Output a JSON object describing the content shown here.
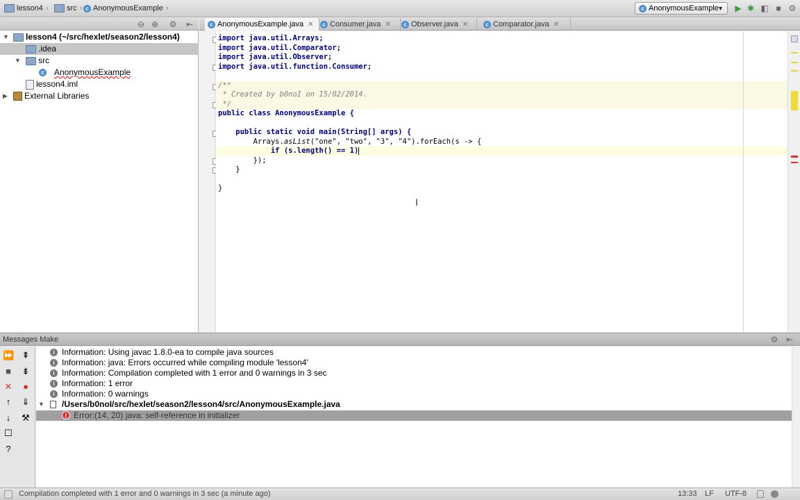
{
  "breadcrumbs": [
    {
      "label": "lesson4",
      "icon": "folder-icon"
    },
    {
      "label": "src",
      "icon": "folder-icon"
    },
    {
      "label": "AnonymousExample",
      "icon": "class-icon"
    }
  ],
  "toolbar": {
    "run_config": "AnonymousExample"
  },
  "project_tree": [
    {
      "label": "lesson4 (~/src/hexlet/season2/lesson4)",
      "icon": "folder-icon",
      "depth": 0,
      "expanded": true
    },
    {
      "label": ".idea",
      "icon": "folder-icon",
      "depth": 1,
      "selected": true
    },
    {
      "label": "src",
      "icon": "folder-icon",
      "depth": 1,
      "expanded": true
    },
    {
      "label": "AnonymousExample",
      "icon": "class-icon",
      "depth": 2
    },
    {
      "label": "lesson4.iml",
      "icon": "file-icon",
      "depth": 1
    },
    {
      "label": "External Libraries",
      "icon": "library-icon",
      "depth": 0,
      "expanded": false
    }
  ],
  "tabs": [
    {
      "label": "AnonymousExample.java",
      "active": true
    },
    {
      "label": "Consumer.java",
      "active": false
    },
    {
      "label": "Observer.java",
      "active": false
    },
    {
      "label": "Comparator.java",
      "active": false
    }
  ],
  "code": {
    "import1": "import java.util.Arrays;",
    "import2": "import java.util.Comparator;",
    "import3": "import java.util.Observer;",
    "import4": "import java.util.function.Consumer;",
    "doc_open": "/**",
    "doc_body": " * Created by b0noI on 15/02/2014.",
    "doc_close": " */",
    "class_decl": "public class AnonymousExample {",
    "main_decl": "    public static void main(String[] args) {",
    "stmt_prefix": "        Arrays.",
    "stmt_method": "asList",
    "stmt_args": "(\"one\", \"two\", \"3\", \"4\").forEach(s -> {",
    "if_line": "            if (s.length() == 1)",
    "close_lambda": "        });",
    "close_method": "    }",
    "close_class": "}"
  },
  "messages": {
    "panel_title": "Messages Make",
    "items": [
      {
        "type": "info",
        "text": "Information: Using javac 1.8.0-ea to compile java sources"
      },
      {
        "type": "info",
        "text": "Information: java: Errors occurred while compiling module 'lesson4'"
      },
      {
        "type": "info",
        "text": "Information: Compilation completed with 1 error and 0 warnings in 3 sec"
      },
      {
        "type": "info",
        "text": "Information: 1 error"
      },
      {
        "type": "info",
        "text": "Information: 0 warnings"
      }
    ],
    "file_path": "/Users/b0noI/src/hexlet/season2/lesson4/src/AnonymousExample.java",
    "error_text": "Error:(14, 20)  java: self-reference in initializer"
  },
  "status": {
    "message": "Compilation completed with 1 error and 0 warnings in 3 sec (a minute ago)",
    "position": "13:33",
    "line_sep": "LF",
    "encoding": "UTF-8"
  }
}
